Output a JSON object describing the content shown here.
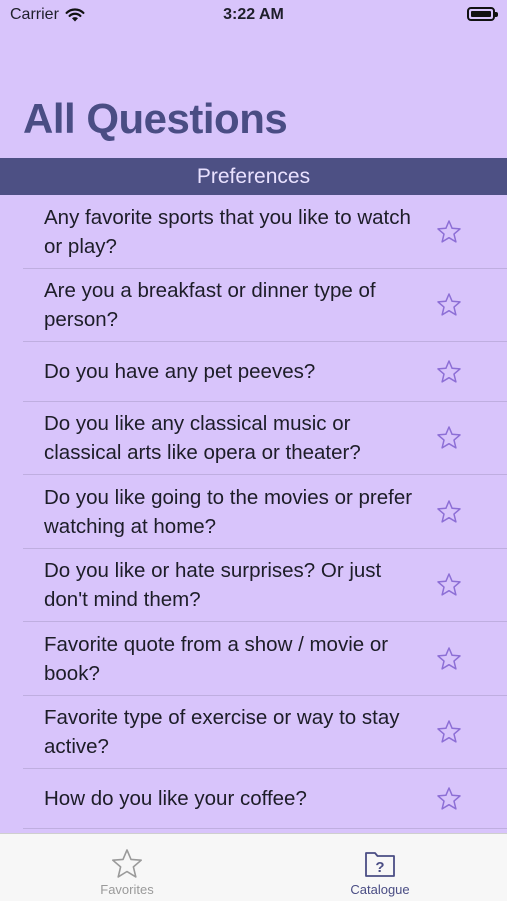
{
  "status_bar": {
    "carrier": "Carrier",
    "time": "3:22 AM"
  },
  "page_title": "All Questions",
  "section_header": "Preferences",
  "questions": [
    {
      "text": "Any favorite sports that you like to watch or play?"
    },
    {
      "text": "Are you a breakfast or dinner type of person?"
    },
    {
      "text": "Do you have any pet peeves?"
    },
    {
      "text": "Do you like any classical music or classical arts like opera or theater?"
    },
    {
      "text": "Do you like going to the movies or prefer watching at home?"
    },
    {
      "text": "Do you like or hate surprises? Or just don't mind them?"
    },
    {
      "text": "Favorite quote from a show / movie or book?"
    },
    {
      "text": "Favorite type of exercise or way to stay active?"
    },
    {
      "text": "How do you like your coffee?"
    }
  ],
  "tab_bar": {
    "favorites_label": "Favorites",
    "catalogue_label": "Catalogue",
    "catalogue_icon_glyph": "?"
  },
  "colors": {
    "background": "#d8c4fb",
    "accent": "#4a4d84",
    "section_header_bg": "#4d5084",
    "star_outline": "#8d6fd6"
  }
}
